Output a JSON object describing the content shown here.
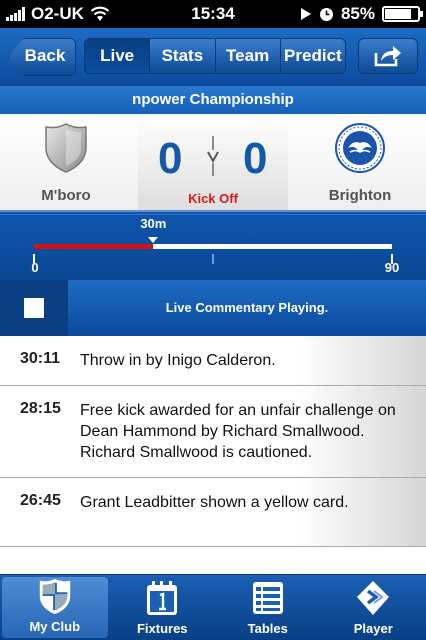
{
  "status_bar": {
    "carrier": "O2-UK",
    "time": "15:34",
    "battery": "85%",
    "battery_level": 0.85
  },
  "nav": {
    "back_label": "Back",
    "tabs": [
      "Live",
      "Stats",
      "Team",
      "Predict"
    ],
    "active_tab": "Live"
  },
  "competition": "npower Championship",
  "match": {
    "home": {
      "name": "M'boro",
      "score": "0"
    },
    "away": {
      "name": "Brighton",
      "score": "0"
    },
    "status": "Kick Off"
  },
  "timeline": {
    "marker_label": "30m",
    "minute": 30,
    "start_label": "0",
    "end_label": "90",
    "max": 90
  },
  "commentary_bar": {
    "text": "Live Commentary Playing."
  },
  "commentary": [
    {
      "time": "30:11",
      "text": "Throw in by Inigo Calderon."
    },
    {
      "time": "28:15",
      "text": "Free kick awarded for an unfair challenge on Dean Hammond by Richard Smallwood. Richard Smallwood is cautioned."
    },
    {
      "time": "26:45",
      "text": "Grant Leadbitter shown a yellow card."
    }
  ],
  "tabbar": {
    "items": [
      {
        "label": "My Club",
        "icon": "shield-icon"
      },
      {
        "label": "Fixtures",
        "icon": "calendar-icon"
      },
      {
        "label": "Tables",
        "icon": "list-icon"
      },
      {
        "label": "Player",
        "icon": "player-icon"
      }
    ],
    "active": "My Club"
  },
  "colors": {
    "brand_blue": "#0b4a9b",
    "score_blue": "#1459a8",
    "kickoff_red": "#d81a1a",
    "progress_red": "#d0131b"
  }
}
